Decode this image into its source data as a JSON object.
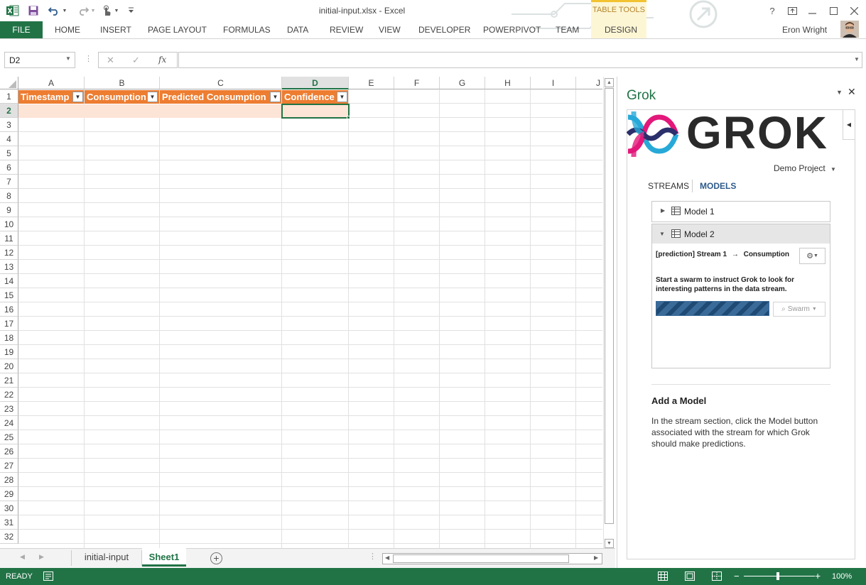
{
  "window": {
    "title": "initial-input.xlsx - Excel",
    "table_tools_label": "TABLE TOOLS",
    "help_label": "?",
    "user_name": "Eron Wright"
  },
  "ribbon": {
    "file_label": "FILE",
    "tabs": [
      "HOME",
      "INSERT",
      "PAGE LAYOUT",
      "FORMULAS",
      "DATA",
      "REVIEW",
      "VIEW",
      "DEVELOPER",
      "POWERPIVOT",
      "TEAM",
      "DESIGN"
    ]
  },
  "formula_bar": {
    "name_box": "D2",
    "cancel_glyph": "✕",
    "enter_glyph": "✓",
    "fx_label": "fx",
    "formula": ""
  },
  "sheet": {
    "columns": [
      "A",
      "B",
      "C",
      "D",
      "E",
      "F",
      "G",
      "H",
      "I",
      "J"
    ],
    "selected_column": "D",
    "selected_row": "2",
    "rows": [
      "1",
      "2",
      "3",
      "4",
      "5",
      "6",
      "7",
      "8",
      "9",
      "10",
      "11",
      "12",
      "13",
      "14",
      "15",
      "16",
      "17",
      "18",
      "19",
      "20",
      "21",
      "22",
      "23",
      "24",
      "25",
      "26",
      "27",
      "28",
      "29",
      "30",
      "31",
      "32"
    ],
    "table_headers": [
      "Timestamp",
      "Consumption",
      "Predicted Consumption",
      "Confidence"
    ],
    "table_header_color": "#ed7d31",
    "table_row_color": "#fce4d6"
  },
  "sheet_tabs": {
    "tabs": [
      "initial-input",
      "Sheet1"
    ],
    "active": "Sheet1"
  },
  "status": {
    "text": "READY",
    "zoom": "100%"
  },
  "task_pane": {
    "title": "Grok",
    "logo_text": "GROK",
    "project": "Demo Project",
    "tabs": [
      "STREAMS",
      "MODELS"
    ],
    "active_tab": "MODELS",
    "models": [
      {
        "name": "Model 1",
        "expanded": false
      },
      {
        "name": "Model 2",
        "expanded": true
      }
    ],
    "model2": {
      "stream_prefix": "[prediction] Stream 1",
      "arrow": "→",
      "stream_target": "Consumption",
      "description": "Start a swarm to instruct Grok to look for interesting patterns in the data stream.",
      "swarm_button": "Swarm"
    },
    "add_model": {
      "title": "Add a Model",
      "text": "In the stream section, click the Model button associated with the stream for which Grok should make predictions."
    }
  },
  "colors": {
    "accent": "#217346",
    "logo_cyan": "#27a9d8",
    "logo_magenta": "#e2187a",
    "logo_navy": "#2b2f6b"
  }
}
